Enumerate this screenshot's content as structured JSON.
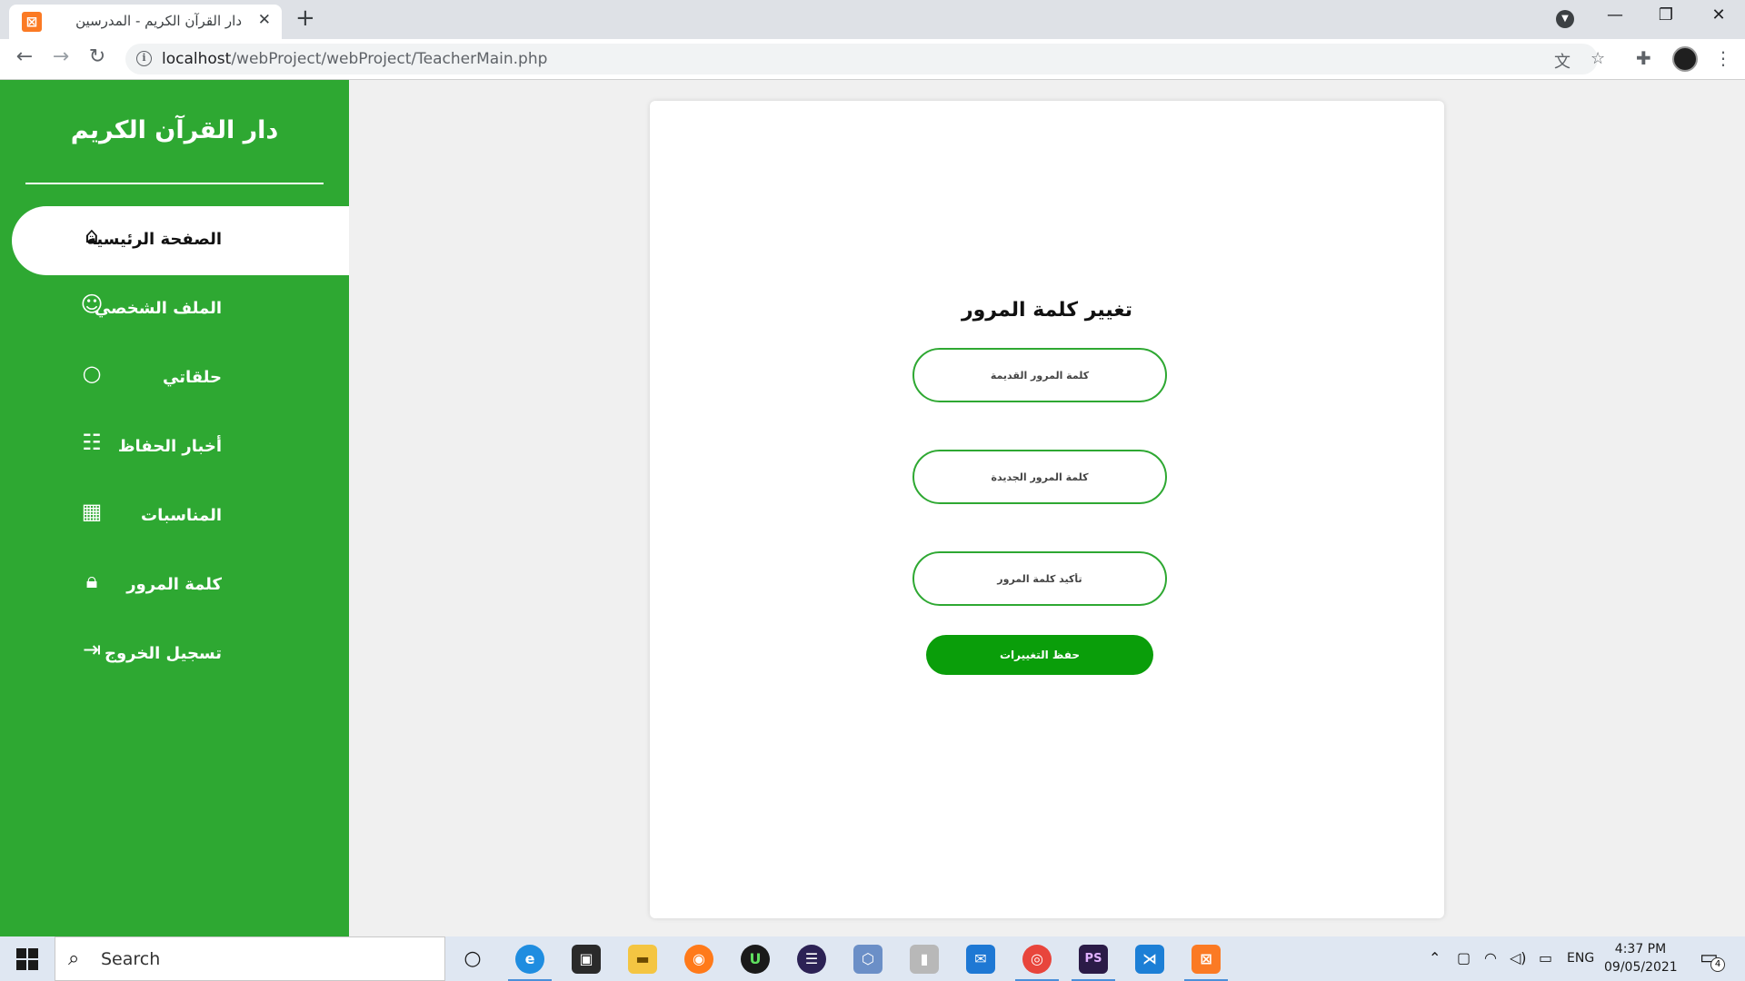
{
  "browser": {
    "tab_title": "دار القرآن الكريم - المدرسين",
    "url_host": "localhost",
    "url_path": "/webProject/webProject/TeacherMain.php"
  },
  "sidebar": {
    "brand": "دار القرآن الكريم",
    "items": [
      {
        "label": "الصفحة الرئيسية",
        "icon": "home-icon",
        "active": true
      },
      {
        "label": "الملف الشخصي",
        "icon": "user-circle-icon"
      },
      {
        "label": "حلقاتي",
        "icon": "circle-icon"
      },
      {
        "label": "أخبار الحفاظ",
        "icon": "newspaper-icon"
      },
      {
        "label": "المناسبات",
        "icon": "calendar-icon"
      },
      {
        "label": "كلمة المرور",
        "icon": "lock-icon"
      },
      {
        "label": "تسجيل الخروج",
        "icon": "logout-icon"
      }
    ]
  },
  "form": {
    "title": "تغيير كلمة المرور",
    "old_password_placeholder": "كلمة المرور القديمة",
    "new_password_placeholder": "كلمة المرور الجديدة",
    "confirm_password_placeholder": "تأكيد كلمة المرور",
    "save_label": "حفظ التغييرات"
  },
  "taskbar": {
    "search_placeholder": "Search",
    "language": "ENG",
    "time": "4:37 PM",
    "date": "09/05/2021",
    "notification_count": "4"
  },
  "colors": {
    "sidebar_green": "#2ea832",
    "button_green": "#0a9e0a"
  }
}
